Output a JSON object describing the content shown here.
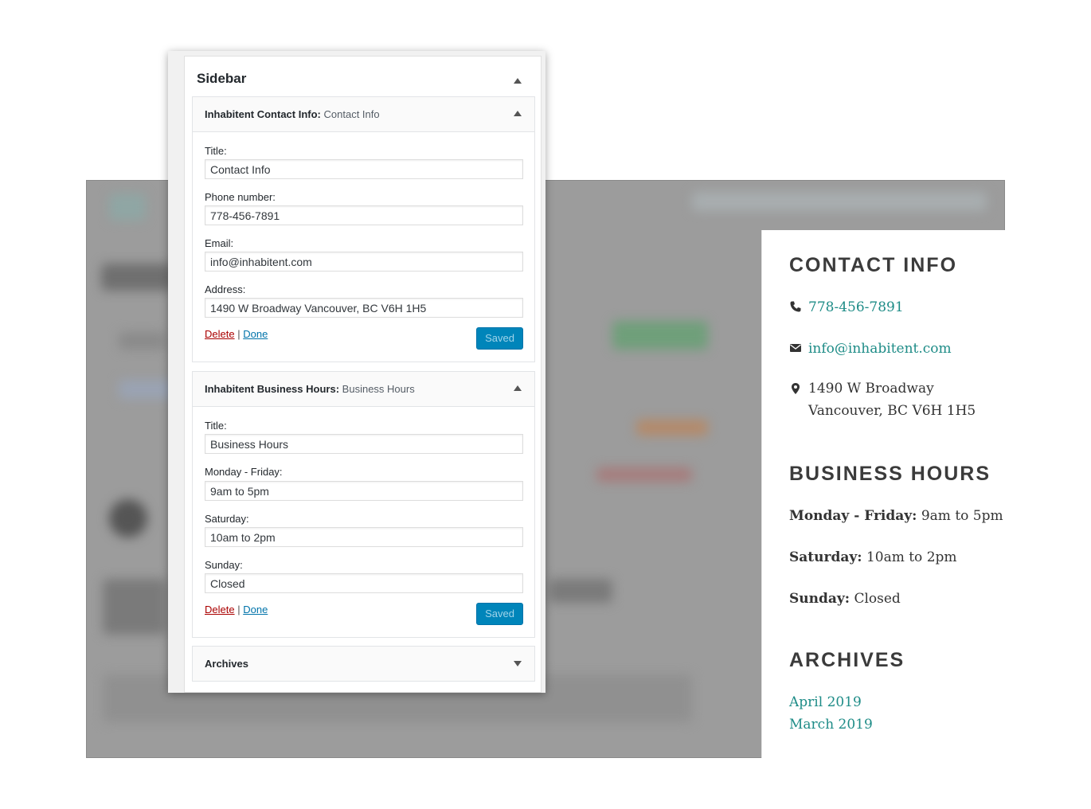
{
  "admin": {
    "sidebar_title": "Sidebar",
    "contact_widget": {
      "name": "Inhabitent Contact Info",
      "separator": ":",
      "subtitle": "Contact Info",
      "fields": [
        {
          "label": "Title:",
          "value": "Contact Info"
        },
        {
          "label": "Phone number:",
          "value": "778-456-7891"
        },
        {
          "label": "Email:",
          "value": "info@inhabitent.com"
        },
        {
          "label": "Address:",
          "value": "1490 W Broadway Vancouver, BC V6H 1H5"
        }
      ],
      "delete_label": "Delete",
      "divider": "|",
      "done_label": "Done",
      "saved_label": "Saved"
    },
    "hours_widget": {
      "name": "Inhabitent Business Hours",
      "separator": ":",
      "subtitle": "Business Hours",
      "fields": [
        {
          "label": "Title:",
          "value": "Business Hours"
        },
        {
          "label": "Monday - Friday:",
          "value": "9am to 5pm"
        },
        {
          "label": "Saturday:",
          "value": "10am to 2pm"
        },
        {
          "label": "Sunday:",
          "value": "Closed"
        }
      ],
      "delete_label": "Delete",
      "divider": "|",
      "done_label": "Done",
      "saved_label": "Saved"
    },
    "archives_widget": {
      "name": "Archives"
    }
  },
  "front": {
    "contact_heading": "CONTACT INFO",
    "phone": "778-456-7891",
    "email": "info@inhabitent.com",
    "address_line1": "1490 W Broadway",
    "address_line2": "Vancouver, BC V6H 1H5",
    "hours_heading": "BUSINESS HOURS",
    "hours": [
      {
        "day": "Monday - Friday:",
        "time": "9am to 5pm"
      },
      {
        "day": "Saturday:",
        "time": "10am to 2pm"
      },
      {
        "day": "Sunday:",
        "time": "Closed"
      }
    ],
    "archives_heading": "ARCHIVES",
    "archives": [
      "April 2019",
      "March 2019"
    ]
  },
  "colors": {
    "link": "#1e8c87",
    "heading": "#3b3b3b",
    "saved_button": "#0085ba",
    "delete_link": "#aa0000",
    "done_link": "#0073aa"
  }
}
